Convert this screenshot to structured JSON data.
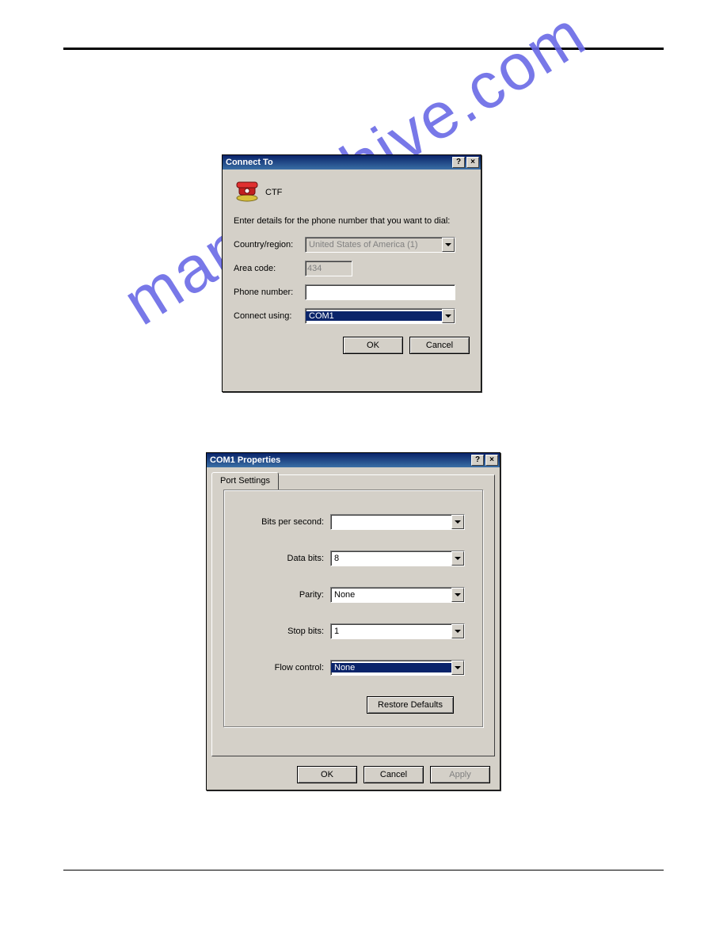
{
  "watermark": "manualshive.com",
  "dialog1": {
    "title": "Connect To",
    "device_label": "CTF",
    "instruction": "Enter details for the phone number that you want to dial:",
    "country_label": "Country/region:",
    "country_value": "United States of America (1)",
    "area_label": "Area code:",
    "area_value": "434",
    "phone_label": "Phone number:",
    "phone_value": "",
    "connect_label": "Connect using:",
    "connect_value": "COM1",
    "ok": "OK",
    "cancel": "Cancel",
    "help_glyph": "?",
    "close_glyph": "×"
  },
  "dialog2": {
    "title": "COM1 Properties",
    "tab_label": "Port Settings",
    "bits_label": "Bits per second:",
    "bits_value": "",
    "databits_label": "Data bits:",
    "databits_value": "8",
    "parity_label": "Parity:",
    "parity_value": "None",
    "stopbits_label": "Stop bits:",
    "stopbits_value": "1",
    "flow_label": "Flow control:",
    "flow_value": "None",
    "restore": "Restore Defaults",
    "ok": "OK",
    "cancel": "Cancel",
    "apply": "Apply",
    "help_glyph": "?",
    "close_glyph": "×"
  }
}
